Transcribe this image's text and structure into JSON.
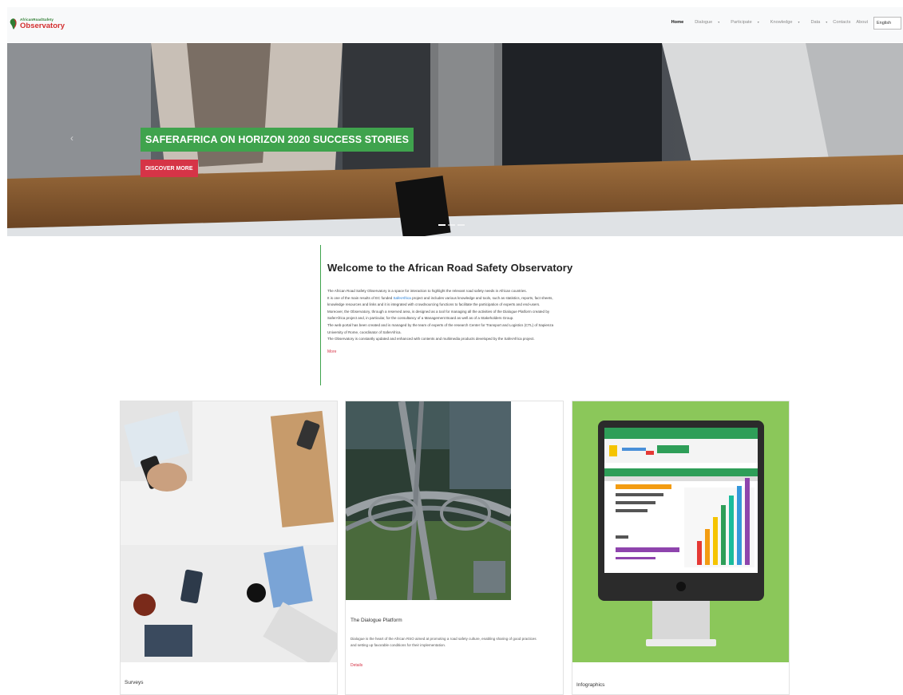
{
  "logo": {
    "top": "AfricanRoadSafety",
    "bottom": "Observatory"
  },
  "nav": {
    "home": "Home",
    "dialogue": "Dialogue",
    "participate": "Participate",
    "knowledge": "Knowledge",
    "data": "Data",
    "contacts": "Contacts",
    "about": "About",
    "language": "English"
  },
  "hero": {
    "title": "SAFERAFRICA ON HORIZON 2020 SUCCESS STORIES",
    "button": "DISCOVER MORE"
  },
  "welcome": {
    "heading": "Welcome to the African Road Safety Observatory",
    "p1": "The African Road Safety Observatory is a space for interaction to highlight the relevant road safety needs in African countries.",
    "p2_before": "It is one of the main results of EC funded ",
    "p2_link": "SaferAfrica",
    "p2_after": " project and includes various knowledge and tools, such as statistics, reports, fact sheets,",
    "p3": "knowledge resources and links and it is integrated with crowdsourcing functions to facilitate the participation of experts and end-users.",
    "p4": "Moreover, the Observatory, through a reserved area, is designed as a tool for managing all the activities of the Dialogue Platform created by",
    "p5": "SaferAfrica project and, in particular, for the consultancy of a Management Board as well as of a Stakeholders Group.",
    "p6": "The web-portal has been created and is managed by the team of experts of the research Center for Transport and Logistics (CTL) of Sapienza",
    "p7": "University of Rome, coordinator of SaferAfrica.",
    "p8": "The Observatory is constantly updated and enhanced with contents and multimedia products developed by the SaferAfrica project.",
    "more": "More"
  },
  "cards": [
    {
      "title": "Surveys"
    },
    {
      "title": "The Dialogue Platform",
      "text1": "Dialogue is the heart of the African RSO aimed at promoting a road safety culture, enabling sharing of good practices",
      "text2": "and setting up favorable conditions for their implementation.",
      "link": "Details"
    },
    {
      "title": "Infographics"
    }
  ],
  "colors": {
    "green": "#3fa34d",
    "red": "#d63447",
    "infographic_bg": "#8bc75a"
  }
}
